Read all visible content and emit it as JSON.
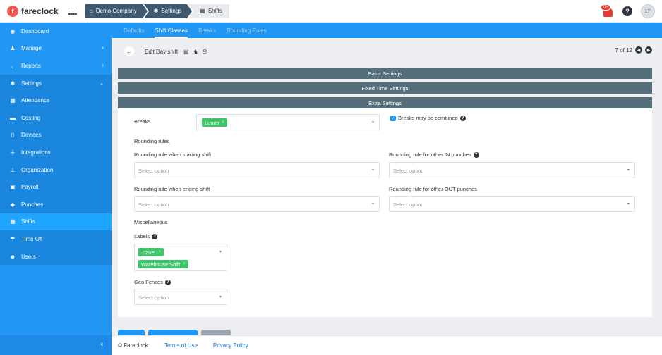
{
  "app": {
    "logo_letter": "f",
    "name": "fareclock"
  },
  "breadcrumbs": [
    {
      "label": "Demo Company",
      "icon": "home-icon"
    },
    {
      "label": "Settings",
      "icon": "gear-icon"
    },
    {
      "label": "Shifts",
      "icon": "calendar-icon"
    }
  ],
  "topbar": {
    "notification_count": "29+",
    "help": "?",
    "avatar_initials": "LT"
  },
  "sidebar": {
    "items": [
      {
        "label": "Dashboard",
        "icon": "dashboard-icon"
      },
      {
        "label": "Manage",
        "icon": "person-icon",
        "chevron": "‹"
      },
      {
        "label": "Reports",
        "icon": "chart-icon",
        "chevron": "‹"
      },
      {
        "label": "Settings",
        "icon": "gear-icon",
        "chevron": "⌄"
      },
      {
        "label": "Attendance",
        "icon": "calendar-icon"
      },
      {
        "label": "Costing",
        "icon": "folder-icon"
      },
      {
        "label": "Devices",
        "icon": "tablet-icon"
      },
      {
        "label": "Integrations",
        "icon": "plug-icon"
      },
      {
        "label": "Organization",
        "icon": "sitemap-icon"
      },
      {
        "label": "Payroll",
        "icon": "money-icon"
      },
      {
        "label": "Punches",
        "icon": "punch-icon"
      },
      {
        "label": "Shifts",
        "icon": "calendar-icon"
      },
      {
        "label": "Time Off",
        "icon": "beach-icon"
      },
      {
        "label": "Users",
        "icon": "users-icon"
      }
    ],
    "collapse": "‹"
  },
  "tabs": [
    "Defaults",
    "Shift Classes",
    "Breaks",
    "Rounding Rules"
  ],
  "edit": {
    "title": "Edit Day shift",
    "pager": "7 of 12"
  },
  "sections": {
    "basic": "Basic Settings",
    "fixed": "Fixed Time Settings",
    "extra": "Extra Settings"
  },
  "form": {
    "breaks_label": "Breaks",
    "breaks_chip": "Lunch",
    "breaks_combined": "Breaks may be combined",
    "rounding_heading": "Rounding rules",
    "start_label": "Rounding rule when starting shift",
    "other_in_label": "Rounding rule for other IN punches",
    "end_label": "Rounding rule when ending shift",
    "other_out_label": "Rounding rule for other OUT punches",
    "placeholder": "Select option",
    "misc_heading": "Miscellaneous",
    "labels_label": "Labels",
    "labels_chips": [
      "Travel",
      "Warehouse Shift"
    ],
    "geo_label": "Geo Fences"
  },
  "footer": {
    "copyright": "© Fareclock",
    "terms": "Terms of Use",
    "privacy": "Privacy Policy"
  },
  "colors": {
    "primary": "#2196f3",
    "section": "#546e7a",
    "chip": "#3ec569"
  }
}
